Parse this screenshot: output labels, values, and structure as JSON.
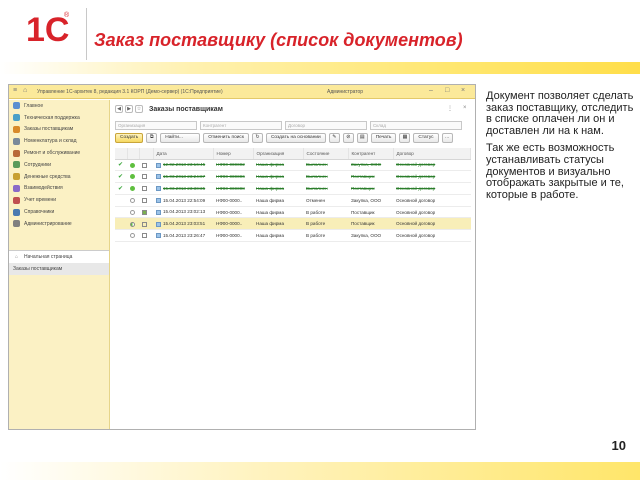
{
  "slide": {
    "title": "Заказ поставщику (список документов)",
    "page_number": "10",
    "logo_text": "1С",
    "description": [
      "Документ позволяет сделать заказ поставщику, отследить в списке оплачен ли он и доставлен ли на к нам.",
      "Так же есть возможность устанавливать статусы документов и визуально отображать закрытые и те, которые в работе."
    ]
  },
  "window": {
    "title": "Управление 1С-архитек 8, редакция 3.1 КОРП (Демо-сервер)  (1С:Предприятие)",
    "user": "Администратор"
  },
  "sidebar": {
    "items": [
      {
        "label": "Главное",
        "icon": "home-icon",
        "color": "#5b8fd0"
      },
      {
        "label": "Техническая поддержка",
        "icon": "support-icon",
        "color": "#4aa0c8"
      },
      {
        "label": "Заказы поставщикам",
        "icon": "orders-icon",
        "color": "#d88a2a"
      },
      {
        "label": "Номенклатура и склад",
        "icon": "warehouse-icon",
        "color": "#7a8a9a"
      },
      {
        "label": "Ремонт и обслуживание",
        "icon": "repair-icon",
        "color": "#b86a3a"
      },
      {
        "label": "Сотрудники",
        "icon": "staff-icon",
        "color": "#5a9a5a"
      },
      {
        "label": "Денежные средства",
        "icon": "money-icon",
        "color": "#c8a030"
      },
      {
        "label": "Взаимодействия",
        "icon": "interaction-icon",
        "color": "#8a6ac8"
      },
      {
        "label": "Учет времени",
        "icon": "clock-icon",
        "color": "#c05050"
      },
      {
        "label": "Справочники",
        "icon": "book-icon",
        "color": "#4a7ab0"
      },
      {
        "label": "Администрирование",
        "icon": "gear-icon",
        "color": "#808080"
      }
    ],
    "bottom": [
      {
        "label": "Начальная страница"
      },
      {
        "label": "Заказы поставщикам"
      }
    ]
  },
  "document": {
    "title": "Заказы поставщикам",
    "filters": [
      "Организация",
      "Контрагент",
      "Договор",
      "Склад"
    ],
    "toolbar": {
      "create": "Создать",
      "find": "Найти...",
      "cancel_search": "Отменить поиск",
      "create_based_on": "Создать на основании",
      "print": "Печать",
      "status": "Статус"
    },
    "columns": [
      "",
      "",
      "",
      "Дата",
      "Номер",
      "Организация",
      "Состояние",
      "Контрагент",
      "Договор"
    ],
    "rows": [
      {
        "check": true,
        "circle": "green",
        "square": "empty",
        "date": "12.02.2013 23:16:45",
        "number": "НФ00-000002",
        "org": "Наша фирма",
        "state": "Выполнен",
        "contractor": "Закупка, ООО",
        "contract": "Основной договор",
        "strike": true,
        "selected": false
      },
      {
        "check": true,
        "circle": "green",
        "square": "empty",
        "date": "15.03.2013 23:24:07",
        "number": "НФ00-000006",
        "org": "Наша фирма",
        "state": "Выполнен",
        "contractor": "Поставщик",
        "contract": "Основной договор",
        "strike": true,
        "selected": false
      },
      {
        "check": true,
        "circle": "green",
        "square": "empty",
        "date": "15.03.2013 23:30:35",
        "number": "НФ00-000008",
        "org": "Наша фирма",
        "state": "Выполнен",
        "contractor": "Поставщик",
        "contract": "Основной договор",
        "strike": true,
        "selected": false
      },
      {
        "check": false,
        "circle": "empty",
        "square": "empty",
        "date": "15.04.2013 22:54:09",
        "number": "НФ00-0000..",
        "org": "Наша фирма",
        "state": "Отменен",
        "contractor": "Закупка, ООО",
        "contract": "Основной договор",
        "strike": false,
        "selected": false
      },
      {
        "check": false,
        "circle": "empty",
        "square": "filled",
        "date": "15.04.2013 23:02:13",
        "number": "НФ00-0000..",
        "org": "Наша фирма",
        "state": "В работе",
        "contractor": "Поставщик",
        "contract": "Основной договор",
        "strike": false,
        "selected": false
      },
      {
        "check": false,
        "circle": "partial",
        "square": "empty",
        "date": "15.04.2013 23:03:51",
        "number": "НФ00-0000..",
        "org": "Наша фирма",
        "state": "В работе",
        "contractor": "Поставщик",
        "contract": "Основной договор",
        "strike": false,
        "selected": true
      },
      {
        "check": false,
        "circle": "empty",
        "square": "empty",
        "date": "15.04.2013 23:26:47",
        "number": "НФ00-0000..",
        "org": "Наша фирма",
        "state": "В работе",
        "contractor": "Закупка, ООО",
        "contract": "Основной договор",
        "strike": false,
        "selected": false
      }
    ]
  }
}
